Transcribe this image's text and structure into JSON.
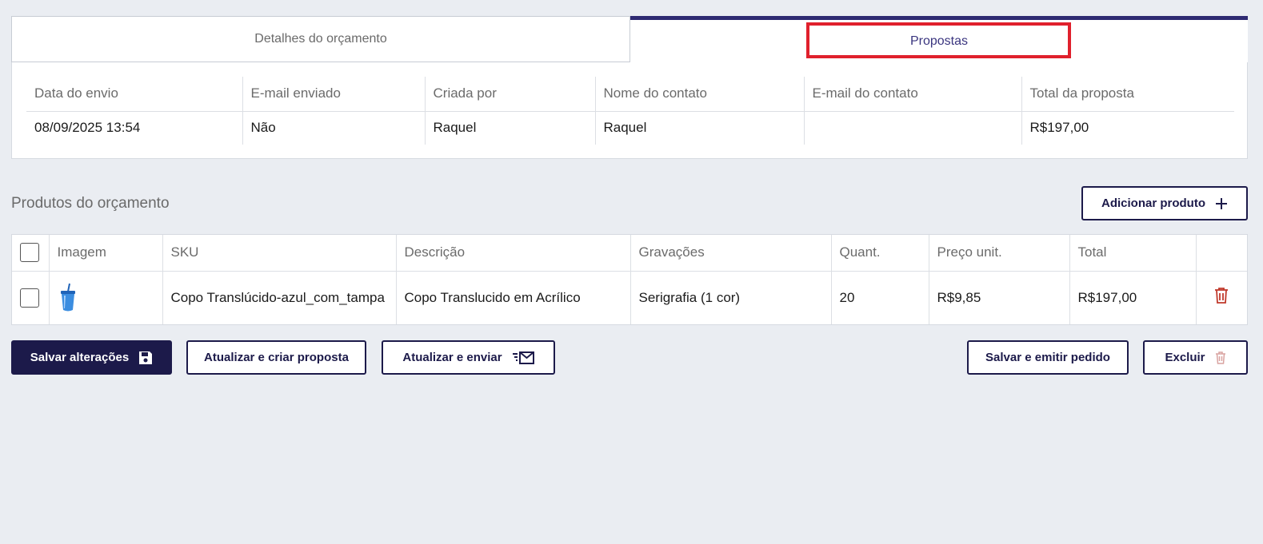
{
  "tabs": {
    "details_label": "Detalhes do orçamento",
    "proposals_label": "Propostas"
  },
  "proposals": {
    "columns": [
      "Data do envio",
      "E-mail enviado",
      "Criada por",
      "Nome do contato",
      "E-mail do contato",
      "Total da proposta"
    ],
    "rows": [
      [
        "08/09/2025 13:54",
        "Não",
        "Raquel",
        "Raquel",
        "",
        "R$197,00"
      ]
    ]
  },
  "products": {
    "title": "Produtos do orçamento",
    "add_label": "Adicionar produto",
    "columns": [
      "Imagem",
      "SKU",
      "Descrição",
      "Gravações",
      "Quant.",
      "Preço unit.",
      "Total"
    ],
    "rows": [
      {
        "image_icon": "blue-tumbler-cup-icon",
        "sku": "Copo Translúcido-azul_com_tampa",
        "description": "Copo Translucido em Acrílico",
        "engraving": "Serigrafia (1 cor)",
        "quantity": "20",
        "unit_price": "R$9,85",
        "total": "R$197,00"
      }
    ]
  },
  "actions": {
    "save_label": "Salvar alterações",
    "update_create_label": "Atualizar e criar proposta",
    "update_send_label": "Atualizar e enviar",
    "save_emit_label": "Salvar e emitir pedido",
    "delete_label": "Excluir"
  },
  "colors": {
    "brand": "#1c1a4a",
    "accent_tab": "#2e2a72",
    "highlight": "#e0202c",
    "danger": "#c0392b",
    "background": "#eaedf2"
  }
}
